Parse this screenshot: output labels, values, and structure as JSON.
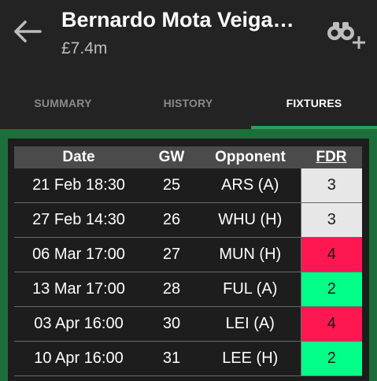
{
  "header": {
    "title": "Bernardo Mota Veiga…",
    "price": "£7.4m",
    "back_icon": "arrow-left-icon",
    "watch_icon": "binoculars-plus-icon"
  },
  "tabs": [
    {
      "label": "SUMMARY",
      "active": false
    },
    {
      "label": "HISTORY",
      "active": false
    },
    {
      "label": "FIXTURES",
      "active": true
    }
  ],
  "colors": {
    "accent_green": "#2f9d57",
    "content_bg": "#1c6f3a",
    "fdr_2": "#00ff87",
    "fdr_3": "#e7e7e7",
    "fdr_4": "#ff1751"
  },
  "fixtures": {
    "columns": [
      "Date",
      "GW",
      "Opponent",
      "FDR"
    ],
    "rows": [
      {
        "date": "21 Feb 18:30",
        "gw": "25",
        "opponent": "ARS (A)",
        "fdr": "3"
      },
      {
        "date": "27 Feb 14:30",
        "gw": "26",
        "opponent": "WHU (H)",
        "fdr": "3"
      },
      {
        "date": "06 Mar 17:00",
        "gw": "27",
        "opponent": "MUN (H)",
        "fdr": "4"
      },
      {
        "date": "13 Mar 17:00",
        "gw": "28",
        "opponent": "FUL (A)",
        "fdr": "2"
      },
      {
        "date": "03 Apr 16:00",
        "gw": "30",
        "opponent": "LEI (A)",
        "fdr": "4"
      },
      {
        "date": "10 Apr 16:00",
        "gw": "31",
        "opponent": "LEE (H)",
        "fdr": "2"
      }
    ]
  }
}
